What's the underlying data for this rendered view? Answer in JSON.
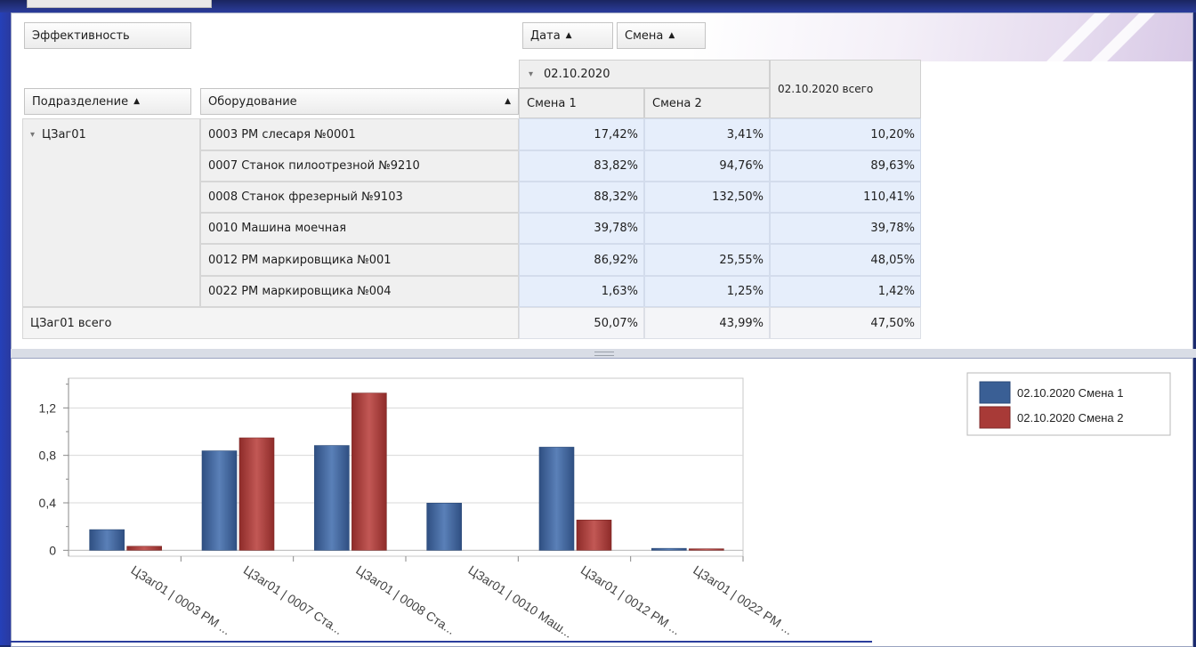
{
  "field_buttons": {
    "data_field": "Эффективность",
    "date_field": "Дата",
    "shift_field": "Смена",
    "department_field": "Подразделение",
    "equipment_field": "Оборудование"
  },
  "sort_glyph": "▲",
  "column_header": {
    "expand_glyph": "▾",
    "date": "02.10.2020",
    "shift1": "Смена 1",
    "shift2": "Смена 2",
    "date_total": "02.10.2020 всего"
  },
  "group": {
    "expand_glyph": "▾",
    "name": "ЦЗаг01"
  },
  "rows": [
    {
      "equipment": "0003 РМ слесаря №0001",
      "s1": "17,42%",
      "s2": "3,41%",
      "total": "10,20%"
    },
    {
      "equipment": "0007 Станок пилоотрезной №9210",
      "s1": "83,82%",
      "s2": "94,76%",
      "total": "89,63%"
    },
    {
      "equipment": "0008 Станок фрезерный №9103",
      "s1": "88,32%",
      "s2": "132,50%",
      "total": "110,41%"
    },
    {
      "equipment": "0010 Машина моечная",
      "s1": "39,78%",
      "s2": "",
      "total": "39,78%"
    },
    {
      "equipment": "0012 РМ маркировщика №001",
      "s1": "86,92%",
      "s2": "25,55%",
      "total": "48,05%"
    },
    {
      "equipment": "0022 РМ маркировщика №004",
      "s1": "1,63%",
      "s2": "1,25%",
      "total": "1,42%"
    }
  ],
  "grand_total": {
    "label": "ЦЗаг01 всего",
    "s1": "50,07%",
    "s2": "43,99%",
    "total": "47,50%"
  },
  "colors": {
    "series1": "#3a5f95",
    "series2": "#a83a37",
    "value_cell": "#e6eefb"
  },
  "chart_data": {
    "type": "bar",
    "categories": [
      "ЦЗаг01 | 0003 РМ ...",
      "ЦЗаг01 | 0007 Ста...",
      "ЦЗаг01 | 0008 Ста...",
      "ЦЗаг01 | 0010 Маш...",
      "ЦЗаг01 | 0012 РМ ...",
      "ЦЗаг01 | 0022 РМ ..."
    ],
    "series": [
      {
        "name": "02.10.2020 Смена 1",
        "values": [
          0.1742,
          0.8382,
          0.8832,
          0.3978,
          0.8692,
          0.0163
        ]
      },
      {
        "name": "02.10.2020 Смена 2",
        "values": [
          0.0341,
          0.9476,
          1.325,
          null,
          0.2555,
          0.0125
        ]
      }
    ],
    "ylim": [
      -0.05,
      1.45
    ],
    "yticks": [
      0,
      0.4,
      0.8,
      1.2
    ],
    "ytick_labels": [
      "0",
      "0,4",
      "0,8",
      "1,2"
    ],
    "grid": true,
    "legend": "top-right"
  }
}
